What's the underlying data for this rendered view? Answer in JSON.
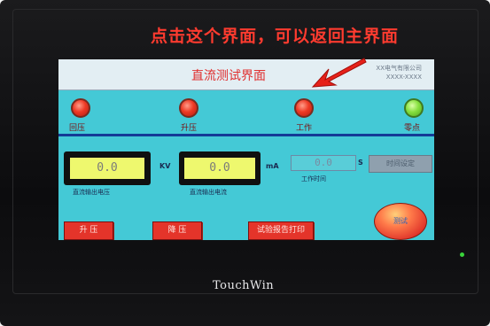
{
  "photo_caption": "点击这个界面，可以返回主界面",
  "screen": {
    "title": "直流测试界面",
    "brand_lines": [
      "XX电气有限公司",
      "XXXX-XXXX"
    ]
  },
  "indicators": [
    {
      "label": "回压",
      "color": "red"
    },
    {
      "label": "升压",
      "color": "red"
    },
    {
      "label": "工作",
      "color": "red"
    },
    {
      "label": "零点",
      "color": "green"
    }
  ],
  "voltage": {
    "value": "0.0",
    "unit": "KV",
    "label": "直流输出电压"
  },
  "current": {
    "value": "0.0",
    "unit": "mA",
    "label": "直流输出电流"
  },
  "timer": {
    "value": "0.0",
    "unit": "S",
    "label": "工作时间"
  },
  "set_button": {
    "label": "时间设定"
  },
  "buttons": {
    "raise": "升 压",
    "lower": "降 压",
    "save": "试验报告打印",
    "test": "测试"
  },
  "device_logo": "TouchWin",
  "colors": {
    "screen_bg": "#44c9d6",
    "caption_red": "#ff3b2f",
    "title_red": "#e03030",
    "readout_yellow": "#eef86e",
    "divider_blue": "#143b96"
  }
}
